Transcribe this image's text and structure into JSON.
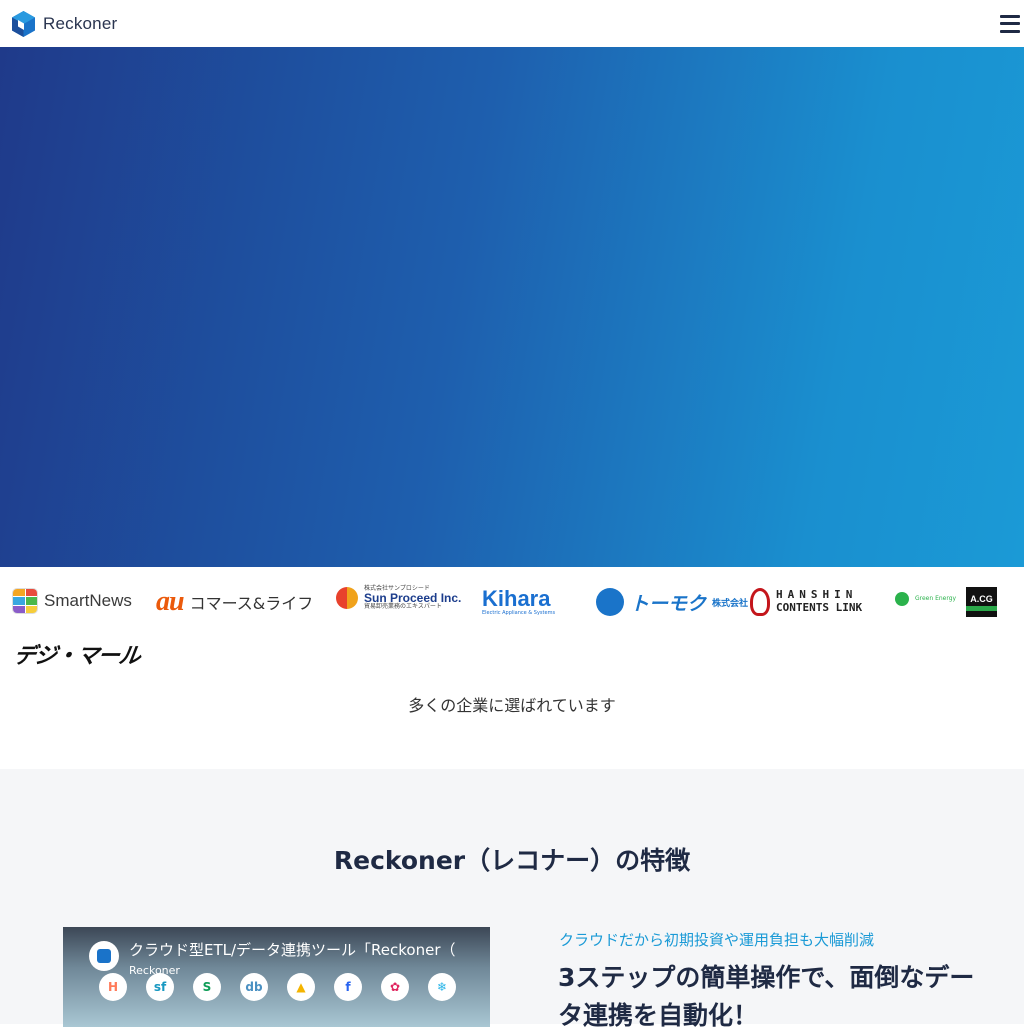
{
  "header": {
    "brand": "Reckoner"
  },
  "logos": {
    "smartnews": "SmartNews",
    "au_mark": "au",
    "au_text": "コマース&ライフ",
    "sun_small_top": "株式会社サンプロシード",
    "sun_name": "Sun Proceed Inc.",
    "sun_small_bottom": "貿易卸売業務のエキスパート",
    "kihara": "Kihara",
    "kihara_sub": "Electric Appliance & Systems",
    "tomoku": "トーモク",
    "tomoku_suffix": "株式会社",
    "hanshin_top": "HANSHIN",
    "hanshin_bottom": "CONTENTS LINK",
    "green": "Green Energy",
    "acg": "A.CG",
    "digimall": "デジ・マール"
  },
  "chosen_text": "多くの企業に選ばれています",
  "features": {
    "title": "Reckoner（レコナー）の特徴",
    "video_title": "クラウド型ETL/データ連携ツール「Reckoner（",
    "video_channel": "Reckoner",
    "video_icons": [
      "H",
      "sf",
      "S",
      "db",
      "▲",
      "f",
      "✿",
      "❄"
    ],
    "eyebrow": "クラウドだから初期投資や運用負担も大幅削減",
    "headline": "3ステップの簡単操作で、面倒なデータ連携を自動化！"
  },
  "colors": {
    "hero_start": "#1f3a8a",
    "hero_end": "#1b9ad6",
    "accent": "#1a9ad6"
  }
}
